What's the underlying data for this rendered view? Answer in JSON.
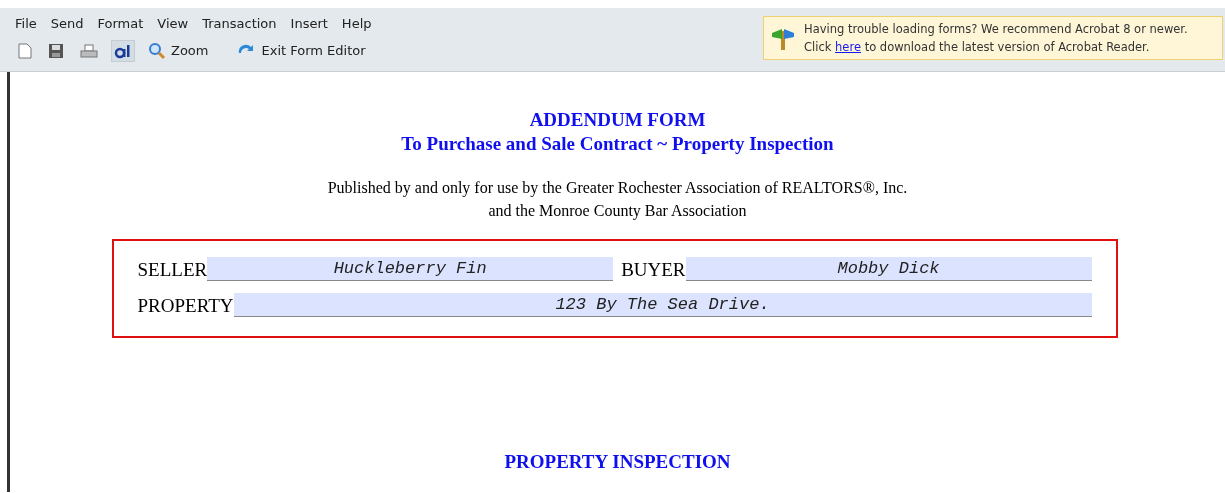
{
  "menu": [
    "File",
    "Send",
    "Format",
    "View",
    "Transaction",
    "Insert",
    "Help"
  ],
  "toolbar": [
    {
      "kind": "new"
    },
    {
      "kind": "save"
    },
    {
      "kind": "print"
    },
    {
      "kind": "text",
      "selected": true
    },
    {
      "kind": "zoom",
      "label": "Zoom"
    },
    {
      "kind": "exit",
      "label": "Exit Form Editor"
    }
  ],
  "notice": {
    "line1": "Having trouble loading forms? We recommend Acrobat 8 or newer.",
    "line2_before": "Click",
    "link": "here",
    "line2_after": "to download the latest version of Acrobat Reader."
  },
  "document": {
    "title": "ADDENDUM FORM",
    "subtitle": "To Purchase and Sale Contract ~ Property Inspection",
    "published": [
      "Published by and only for use by the Greater Rochester Association of REALTORS®, Inc.",
      "and the Monroe County Bar Association"
    ],
    "fields": [
      [
        {
          "label": "SELLER",
          "value": "Huckleberry Fin"
        },
        {
          "label": "BUYER",
          "value": "Mobby Dick"
        }
      ],
      [
        {
          "label": "PROPERTY",
          "value": "123 By The Sea Drive."
        }
      ]
    ],
    "section_heading": "PROPERTY INSPECTION"
  }
}
